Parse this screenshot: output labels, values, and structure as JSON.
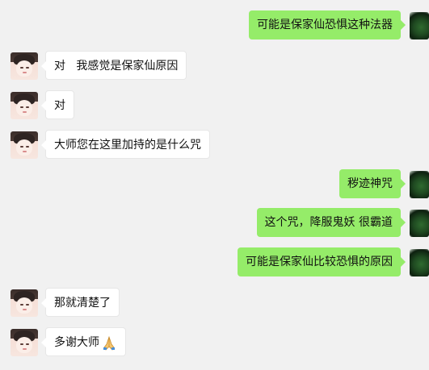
{
  "colors": {
    "background": "#f1f1f1",
    "outgoing_bubble": "#95ec69",
    "incoming_bubble": "#ffffff",
    "text": "#111111"
  },
  "messages": [
    {
      "side": "right",
      "text": "可能是保家仙恐惧这种法器",
      "avatar": "green-orb-avatar-icon"
    },
    {
      "side": "left",
      "text": "对   我感觉是保家仙原因",
      "avatar": "anime-boy-avatar-icon"
    },
    {
      "side": "left",
      "text": "对",
      "avatar": "anime-boy-avatar-icon"
    },
    {
      "side": "left",
      "text": "大师您在这里加持的是什么咒",
      "avatar": "anime-boy-avatar-icon"
    },
    {
      "side": "right",
      "text": "秽迹神咒",
      "avatar": "green-orb-avatar-icon"
    },
    {
      "side": "right",
      "text": "这个咒，降服鬼妖 很霸道",
      "avatar": "green-orb-avatar-icon"
    },
    {
      "side": "right",
      "text": "可能是保家仙比较恐惧的原因",
      "avatar": "green-orb-avatar-icon"
    },
    {
      "side": "left",
      "text": "那就清楚了",
      "avatar": "anime-boy-avatar-icon"
    },
    {
      "side": "left",
      "text": "多谢大师",
      "avatar": "anime-boy-avatar-icon",
      "emoji": "folded-hands-icon"
    }
  ]
}
